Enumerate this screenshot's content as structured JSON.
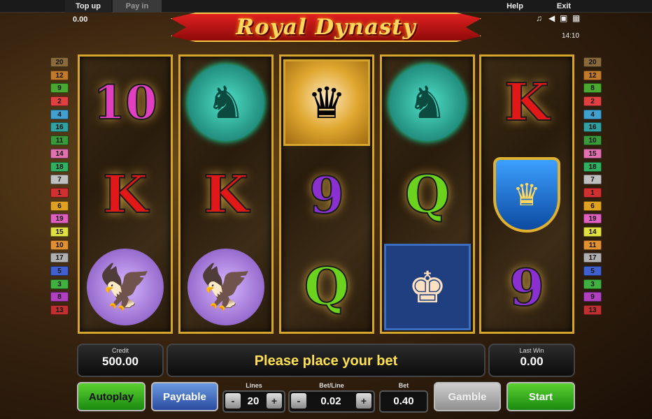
{
  "topbar": {
    "top_up": "Top up",
    "pay_in": "Pay in",
    "help": "Help",
    "exit": "Exit",
    "balance": "0.00",
    "clock": "14:10"
  },
  "logo": {
    "title": "Royal Dynasty"
  },
  "paylines_left": [
    "20",
    "12",
    "9",
    "2",
    "4",
    "16",
    "11",
    "14",
    "18",
    "7",
    "1",
    "6",
    "19",
    "15",
    "10",
    "17",
    "5",
    "3",
    "8",
    "13"
  ],
  "paylines_right": [
    "20",
    "12",
    "8",
    "2",
    "4",
    "16",
    "10",
    "15",
    "18",
    "7",
    "1",
    "6",
    "19",
    "14",
    "11",
    "17",
    "5",
    "3",
    "9",
    "13"
  ],
  "payline_colors": [
    "#8a6a3a",
    "#c07a2a",
    "#4aa830",
    "#e04040",
    "#40a0d0",
    "#30a0a0",
    "#3a9a3a",
    "#e070b0",
    "#30b060",
    "#c0c0c0",
    "#d03030",
    "#e0a020",
    "#e060c0",
    "#e0e040",
    "#e09030",
    "#b0b0b0",
    "#4060d0",
    "#40b040",
    "#b040c0",
    "#c03030"
  ],
  "reels": [
    [
      {
        "type": "card",
        "text": "10",
        "cls": "c10"
      },
      {
        "type": "card",
        "text": "K",
        "cls": "cK"
      },
      {
        "type": "falcon"
      }
    ],
    [
      {
        "type": "lion"
      },
      {
        "type": "card",
        "text": "K",
        "cls": "cK"
      },
      {
        "type": "falcon"
      }
    ],
    [
      {
        "type": "queen"
      },
      {
        "type": "card",
        "text": "9",
        "cls": "c9"
      },
      {
        "type": "card",
        "text": "Q",
        "cls": "cQ"
      }
    ],
    [
      {
        "type": "lion"
      },
      {
        "type": "card",
        "text": "Q",
        "cls": "cQ"
      },
      {
        "type": "king"
      }
    ],
    [
      {
        "type": "card",
        "text": "K",
        "cls": "cK"
      },
      {
        "type": "shield"
      },
      {
        "type": "card",
        "text": "9",
        "cls": "c9"
      }
    ]
  ],
  "panels": {
    "credit_label": "Credit",
    "credit_value": "500.00",
    "message": "Please place your bet",
    "lastwin_label": "Last Win",
    "lastwin_value": "0.00"
  },
  "controls": {
    "autoplay": "Autoplay",
    "paytable": "Paytable",
    "lines_label": "Lines",
    "lines_value": "20",
    "betline_label": "Bet/Line",
    "betline_value": "0.02",
    "bet_label": "Bet",
    "bet_value": "0.40",
    "gamble": "Gamble",
    "start": "Start",
    "minus": "-",
    "plus": "+"
  }
}
